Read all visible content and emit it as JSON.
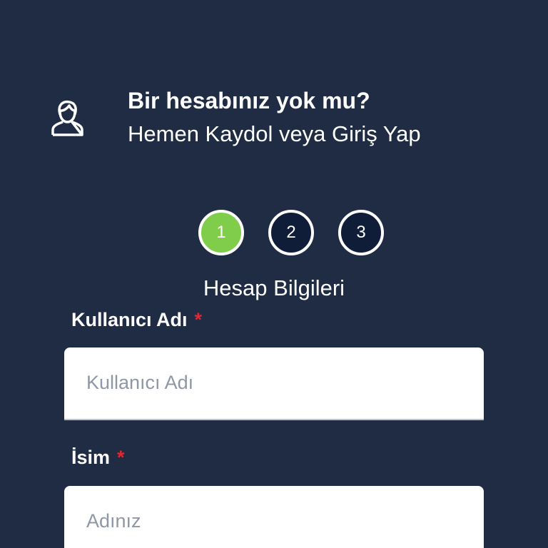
{
  "header": {
    "icon": "user-icon",
    "title": "Bir hesabınız yok mu?",
    "subtitle": "Hemen Kaydol veya Giriş Yap"
  },
  "stepper": {
    "steps": [
      {
        "label": "1",
        "active": true
      },
      {
        "label": "2",
        "active": false
      },
      {
        "label": "3",
        "active": false
      }
    ],
    "current_title": "Hesap Bilgileri"
  },
  "form": {
    "username": {
      "label": "Kullanıcı Adı",
      "required_mark": "*",
      "value": "",
      "placeholder": "Kullanıcı Adı"
    },
    "name": {
      "label": "İsim",
      "required_mark": "*",
      "value": "",
      "placeholder": "Adınız"
    }
  },
  "colors": {
    "background": "#1f2c43",
    "step_active": "#7fcd4a",
    "step_inactive": "#0f1d38",
    "required": "#e3262f"
  }
}
